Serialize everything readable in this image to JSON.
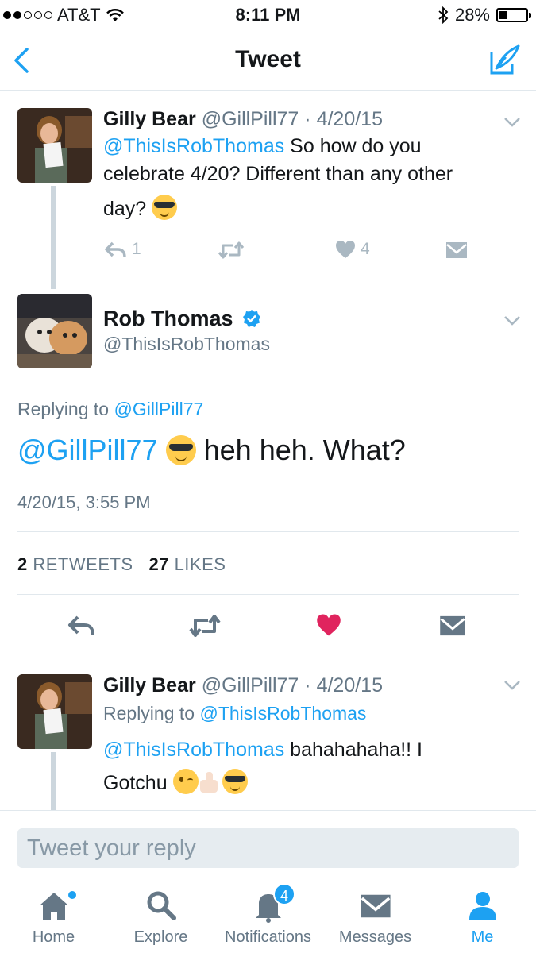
{
  "status_bar": {
    "carrier": "AT&T",
    "time": "8:11 PM",
    "battery": "28%",
    "battery_level": 0.28,
    "signal_bars": 2,
    "signal_total": 5
  },
  "header": {
    "title": "Tweet",
    "back_icon": "chevron-left-icon",
    "compose_icon": "compose-icon",
    "accent_color": "#1da1f2"
  },
  "tweet1": {
    "name": "Gilly Bear",
    "handle": "@GillPill77",
    "separator": "·",
    "date": "4/20/15",
    "mention": "@ThisIsRobThomas",
    "text_line1": " So how do you",
    "text_line2": "celebrate 4/20? Different than any other",
    "text_line3": "day?",
    "reply_count": "1",
    "like_count": "4"
  },
  "main_tweet": {
    "name": "Rob Thomas",
    "handle": "@ThisIsRobThomas",
    "verified": true,
    "replying_label": "Replying to",
    "replying_to": "@GillPill77",
    "mention": "@GillPill77",
    "text": "heh heh. What?",
    "timestamp": "4/20/15, 3:55 PM",
    "retweets_count": "2",
    "retweets_label": "RETWEETS",
    "likes_count": "27",
    "likes_label": "LIKES",
    "liked": true,
    "like_color": "#e0245e"
  },
  "tweet3": {
    "name": "Gilly Bear",
    "handle": "@GillPill77",
    "separator": "·",
    "date": "4/20/15",
    "replying_label": "Replying to",
    "replying_to": "@ThisIsRobThomas",
    "mention": "@ThisIsRobThomas",
    "text_after_mention": " bahahahaha!! I",
    "text_line2": "Gotchu"
  },
  "reply_bar": {
    "placeholder": "Tweet your reply"
  },
  "tab_bar": {
    "home": "Home",
    "explore": "Explore",
    "notifications": "Notifications",
    "notifications_badge": "4",
    "messages": "Messages",
    "me": "Me"
  }
}
